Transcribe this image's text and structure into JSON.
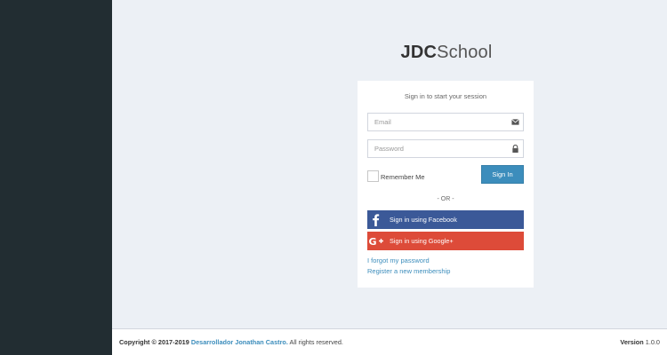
{
  "brand": {
    "bold": "JDC",
    "light": "School"
  },
  "login": {
    "message": "Sign in to start your session",
    "email_placeholder": "Email",
    "password_placeholder": "Password",
    "remember_label": "Remember Me",
    "signin_label": "Sign In",
    "or_label": "- OR -",
    "facebook_label": "Sign in using Facebook",
    "google_label": "Sign in using Google+",
    "forgot_label": "I forgot my password",
    "register_label": "Register a new membership",
    "icons": {
      "email": "envelope-icon",
      "password": "lock-icon",
      "facebook": "facebook-icon",
      "google": "google-plus-icon"
    }
  },
  "footer": {
    "copyright_prefix": "Copyright © 2017-2019",
    "author": "Desarrollador Jonathan Castro.",
    "rights": "All rights reserved.",
    "version_label": "Version",
    "version_value": "1.0.0"
  },
  "colors": {
    "sidebar": "#222d32",
    "background": "#ecf0f5",
    "primary": "#3c8dbc",
    "facebook": "#3b5998",
    "google": "#dd4b39"
  }
}
